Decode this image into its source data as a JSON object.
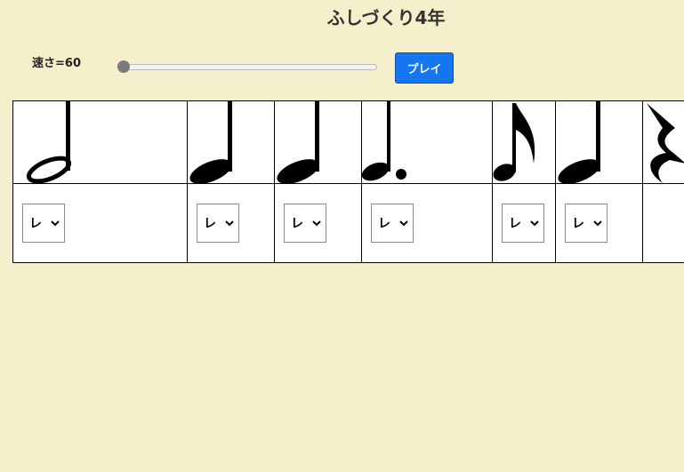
{
  "header": {
    "title": "ふしづくり4年"
  },
  "controls": {
    "speed_label": "速さ=60",
    "speed_value": 60,
    "speed_slider_fraction": 0.0,
    "play_label": "プレイ"
  },
  "icons": {
    "note_icons": [
      "half-note",
      "quarter-note",
      "quarter-note",
      "dotted-quarter-note",
      "eighth-note",
      "quarter-note",
      "quarter-rest"
    ],
    "select_icon": "chevron-down-icon"
  },
  "score": {
    "selects": [
      {
        "value": "レ"
      },
      {
        "value": "レ"
      },
      {
        "value": "レ"
      },
      {
        "value": "レ"
      },
      {
        "value": "レ"
      },
      {
        "value": "レ"
      }
    ]
  },
  "colors": {
    "background": "#f6efcc",
    "play_button": "#1576f1",
    "slider_thumb": "#7a7a7a"
  }
}
